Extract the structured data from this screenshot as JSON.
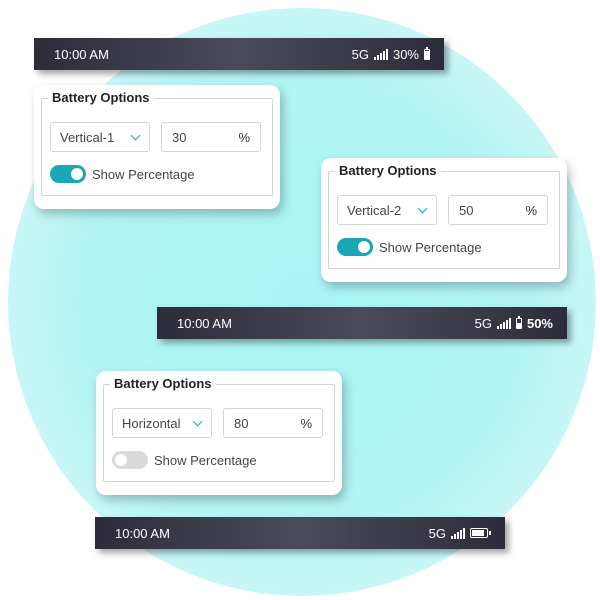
{
  "statusbars": [
    {
      "time": "10:00 AM",
      "network": "5G",
      "battery_text": "30%",
      "battery_level": 30,
      "battery_style": "vertical-1"
    },
    {
      "time": "10:00 AM",
      "network": "5G",
      "battery_text": "50%",
      "battery_level": 50,
      "battery_style": "vertical-2"
    },
    {
      "time": "10:00 AM",
      "network": "5G",
      "battery_text": "",
      "battery_level": 80,
      "battery_style": "horizontal"
    }
  ],
  "panels": [
    {
      "legend": "Battery Options",
      "style_select": "Vertical-1",
      "percentage_value": "30",
      "percent_unit": "%",
      "toggle_label": "Show Percentage",
      "show_percentage": true
    },
    {
      "legend": "Battery Options",
      "style_select": "Vertical-2",
      "percentage_value": "50",
      "percent_unit": "%",
      "toggle_label": "Show Percentage",
      "show_percentage": true
    },
    {
      "legend": "Battery Options",
      "style_select": "Horizontal",
      "percentage_value": "80",
      "percent_unit": "%",
      "toggle_label": "Show Percentage",
      "show_percentage": false
    }
  ],
  "colors": {
    "accent": "#1aa6b7",
    "statusbar_bg": "#3a3a4a",
    "backdrop": "#b3f4f4"
  }
}
